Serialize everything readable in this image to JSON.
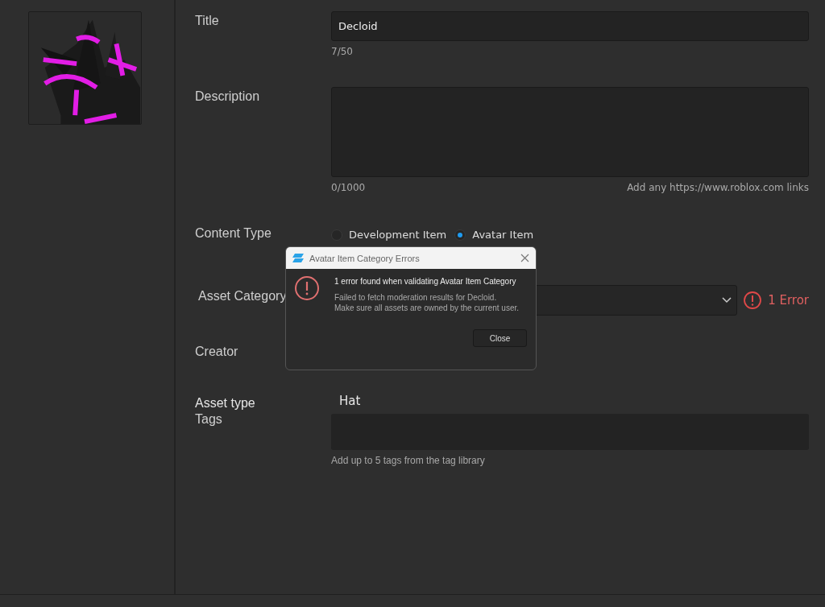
{
  "title_field": {
    "label": "Title",
    "value": "Decloid",
    "counter": "7/50"
  },
  "description": {
    "label": "Description",
    "counter": "0/1000",
    "hint": "Add any https://www.roblox.com links"
  },
  "content_type": {
    "label": "Content Type",
    "options": [
      {
        "label": "Development Item",
        "selected": false
      },
      {
        "label": "Avatar Item",
        "selected": true
      }
    ]
  },
  "asset_category": {
    "label": "Asset Category",
    "error": "1 Error"
  },
  "creator": {
    "label": "Creator"
  },
  "asset_type": {
    "label": "Asset type",
    "value": "Hat"
  },
  "tags": {
    "label": "Tags",
    "hint": "Add up to 5 tags from the tag library"
  },
  "dialog": {
    "title": "Avatar Item Category Errors",
    "heading": "1 error found when validating Avatar Item Category",
    "message": "Failed to fetch moderation results for Decloid.\nMake sure all assets are owned by the current user.",
    "button": "Close"
  }
}
